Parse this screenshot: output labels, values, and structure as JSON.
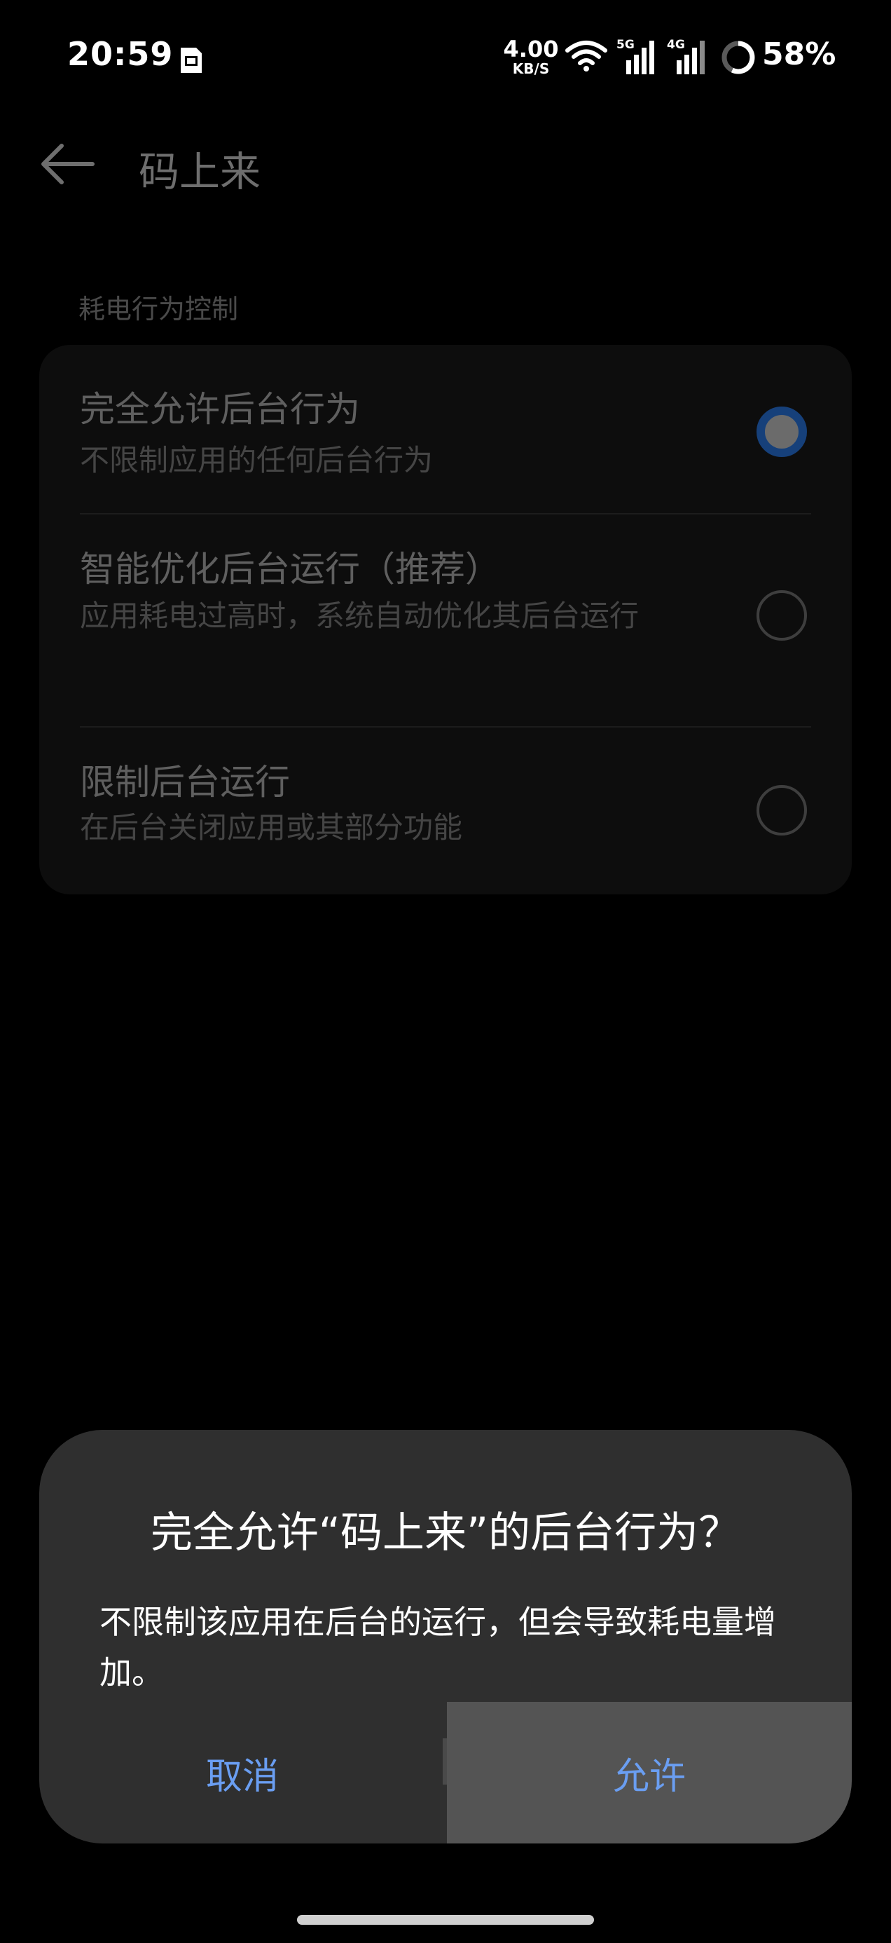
{
  "status_bar": {
    "time": "20:59",
    "net_speed_value": "4.00",
    "net_speed_unit": "KB/S",
    "sig1_label": "5G",
    "sig2_label": "4G",
    "battery": "58%"
  },
  "app_bar": {
    "title": "码上来"
  },
  "section_label": "耗电行为控制",
  "options": [
    {
      "title": "完全允许后台行为",
      "desc": "不限制应用的任何后台行为",
      "selected": true
    },
    {
      "title": "智能优化后台运行（推荐）",
      "desc": "应用耗电过高时，系统自动优化其后台运行",
      "selected": false
    },
    {
      "title": "限制后台运行",
      "desc": "在后台关闭应用或其部分功能",
      "selected": false
    }
  ],
  "dialog": {
    "title": "完全允许“码上来”的后台行为？",
    "message": "不限制该应用在后台的运行，但会导致耗电量增加。",
    "cancel_label": "取消",
    "allow_label": "允许"
  },
  "colors": {
    "accent": "#6a9ef2",
    "radio_selected_ring": "#16407a",
    "dialog_bg": "#2f2f2f"
  }
}
